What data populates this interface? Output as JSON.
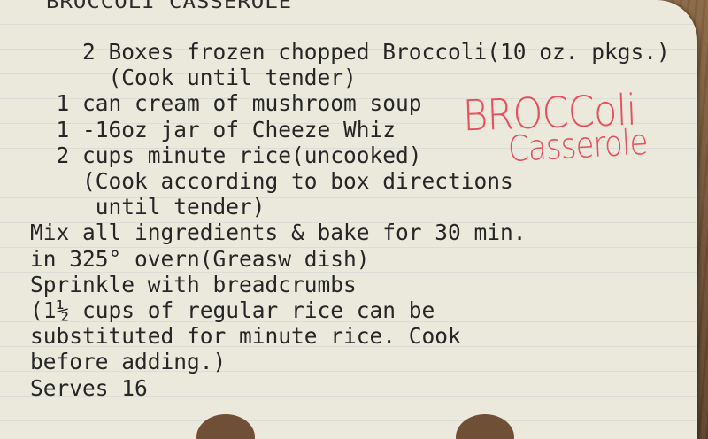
{
  "card": {
    "title_partial": "BROCCOLI CASSEROLE",
    "handwritten_title_line1": "BROCColi",
    "handwritten_title_line2": "Casserole",
    "lines": [
      "    2 Boxes frozen chopped Broccoli(10 oz. pkgs.)",
      "      (Cook until tender)",
      "  1 can cream of mushroom soup",
      "  1 -16oz jar of Cheeze Whiz",
      "  2 cups minute rice(uncooked)",
      "    (Cook according to box directions",
      "     until tender)",
      "Mix all ingredients & bake for 30 min.",
      "in 325° overn(Greasw dish)",
      "Sprinkle with breadcrumbs",
      "(1½ cups of regular rice can be",
      "substituted for minute rice. Cook",
      "before adding.)",
      "Serves 16"
    ]
  }
}
